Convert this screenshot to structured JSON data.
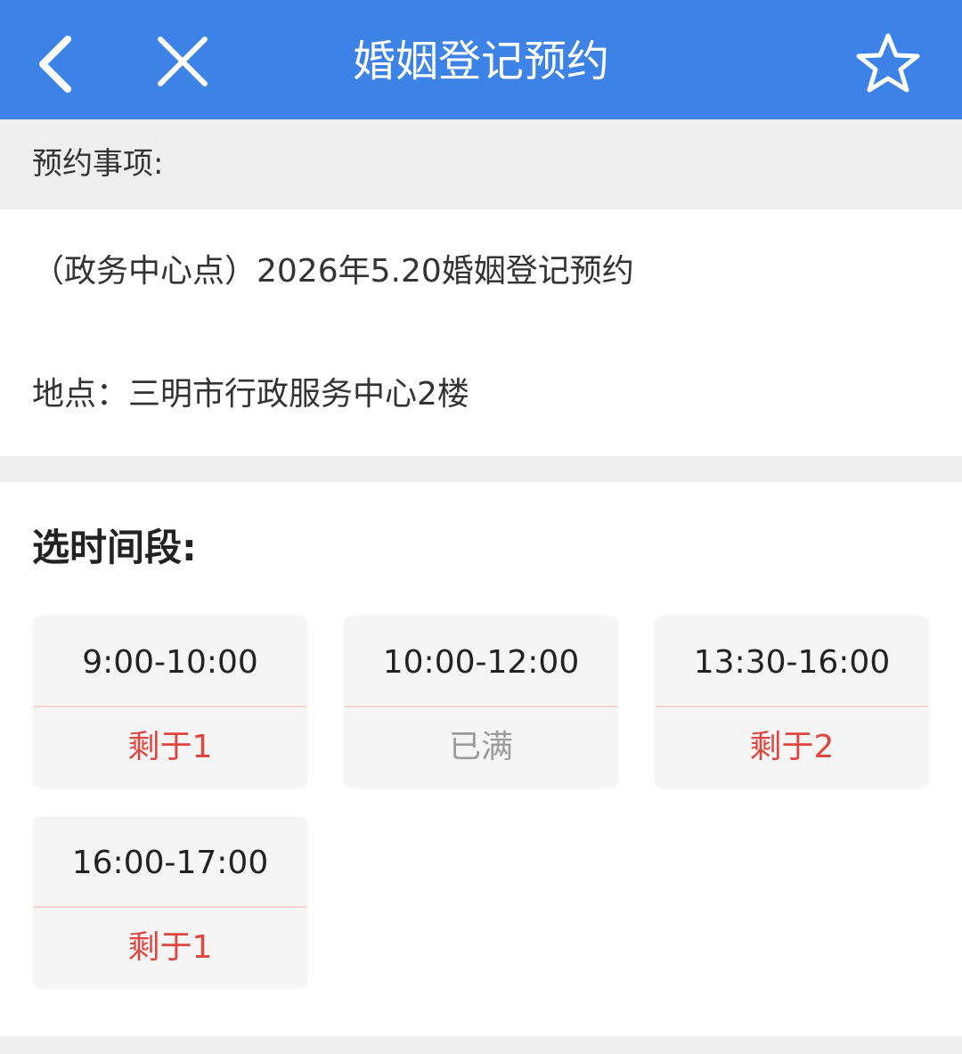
{
  "header": {
    "title": "婚姻登记预约",
    "back_icon": "chevron-left-icon",
    "close_icon": "close-icon",
    "favorite_icon": "star-icon",
    "background_color": "#3d82e7"
  },
  "appointment": {
    "section_label": "预约事项:",
    "item_name": "（政务中心点）2026年5.20婚姻登记预约",
    "location": "地点：三明市行政服务中心2楼"
  },
  "time_slots": {
    "title": "选时间段:",
    "slots": [
      {
        "time": "9:00-10:00",
        "status": "剩于1"
      },
      {
        "time": "10:00-12:00",
        "status": "已满"
      },
      {
        "time": "13:30-16:00",
        "status": "剩于2"
      },
      {
        "time": "16:00-17:00",
        "status": "剩于1"
      }
    ],
    "available_color": "#e0463f",
    "full_color": "#9b9b9b"
  }
}
